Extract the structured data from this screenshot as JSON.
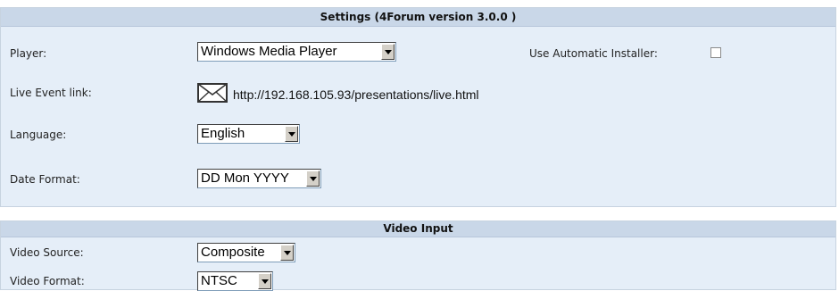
{
  "settings": {
    "header": "Settings (4Forum version 3.0.0 )",
    "player": {
      "label": "Player:",
      "value": "Windows Media Player"
    },
    "auto_installer": {
      "label": "Use Automatic Installer:",
      "checked": false
    },
    "live_event": {
      "label": "Live Event link:",
      "icon": "envelope-icon",
      "url": "http://192.168.105.93/presentations/live.html"
    },
    "language": {
      "label": "Language:",
      "value": "English"
    },
    "date_format": {
      "label": "Date Format:",
      "value": "DD Mon YYYY"
    }
  },
  "video_input": {
    "header": "Video Input",
    "source": {
      "label": "Video Source:",
      "value": "Composite"
    },
    "format": {
      "label": "Video Format:",
      "value": "NTSC"
    }
  },
  "colors": {
    "panel_bg": "#e5eef8",
    "header_bg": "#c9d7e8"
  }
}
